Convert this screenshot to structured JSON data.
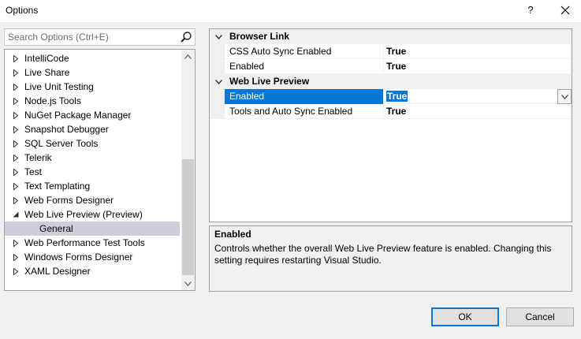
{
  "window": {
    "title": "Options",
    "help_label": "?",
    "close_label": "✕"
  },
  "search": {
    "placeholder": "Search Options (Ctrl+E)"
  },
  "tree": {
    "items": [
      {
        "label": "IntelliCode",
        "expander": "collapsed"
      },
      {
        "label": "Live Share",
        "expander": "collapsed"
      },
      {
        "label": "Live Unit Testing",
        "expander": "collapsed"
      },
      {
        "label": "Node.js Tools",
        "expander": "collapsed"
      },
      {
        "label": "NuGet Package Manager",
        "expander": "collapsed"
      },
      {
        "label": "Snapshot Debugger",
        "expander": "collapsed"
      },
      {
        "label": "SQL Server Tools",
        "expander": "collapsed"
      },
      {
        "label": "Telerik",
        "expander": "collapsed"
      },
      {
        "label": "Test",
        "expander": "collapsed"
      },
      {
        "label": "Text Templating",
        "expander": "collapsed"
      },
      {
        "label": "Web Forms Designer",
        "expander": "collapsed"
      },
      {
        "label": "Web Live Preview (Preview)",
        "expander": "expanded"
      },
      {
        "label": "General",
        "expander": "none",
        "selected": true
      },
      {
        "label": "Web Performance Test Tools",
        "expander": "collapsed"
      },
      {
        "label": "Windows Forms Designer",
        "expander": "collapsed"
      },
      {
        "label": "XAML Designer",
        "expander": "collapsed"
      }
    ]
  },
  "grid": {
    "categories": [
      {
        "label": "Browser Link",
        "properties": [
          {
            "name": "CSS Auto Sync Enabled",
            "value": "True"
          },
          {
            "name": "Enabled",
            "value": "True"
          }
        ]
      },
      {
        "label": "Web Live Preview",
        "properties": [
          {
            "name": "Enabled",
            "value": "True",
            "selected": true
          },
          {
            "name": "Tools and Auto Sync Enabled",
            "value": "True"
          }
        ]
      }
    ]
  },
  "description": {
    "title": "Enabled",
    "text": "Controls whether the overall Web Live Preview feature is enabled. Changing this setting requires restarting Visual Studio."
  },
  "buttons": {
    "ok": "OK",
    "cancel": "Cancel"
  },
  "colors": {
    "accent": "#0078d7",
    "tree_selection": "#cccedb"
  }
}
